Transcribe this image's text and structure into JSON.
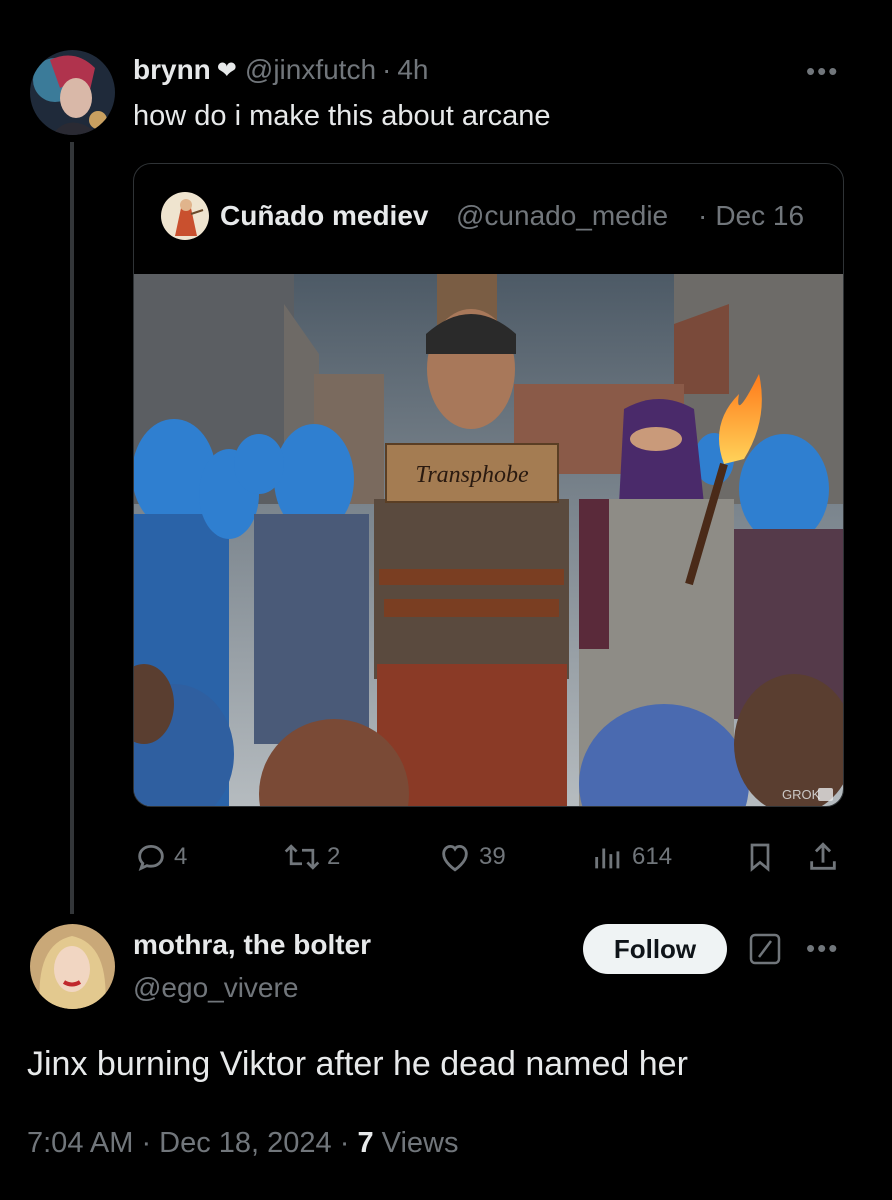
{
  "tweet": {
    "display_name": "brynn",
    "heart_glyph": "❤",
    "handle": "@jinxfutch",
    "separator": "·",
    "time": "4h",
    "text": "how do i make this about arcane",
    "more": "•••"
  },
  "quote": {
    "display_name": "Cuñado mediev",
    "handle": "@cunado_medie",
    "separator": "·",
    "date": "Dec 16",
    "image": {
      "sign_text": "Transphobe",
      "watermark": "GROK"
    }
  },
  "actions": {
    "replies": "4",
    "reposts": "2",
    "likes": "39",
    "views": "614"
  },
  "reply": {
    "display_name": "mothra, the bolter",
    "handle": "@ego_vivere",
    "follow_label": "Follow",
    "more": "•••",
    "text": "Jinx burning Viktor after he dead named her",
    "timestamp": "7:04 AM · Dec 18, 2024 ·",
    "views_count": "7",
    "views_label": "Views"
  },
  "colors": {
    "background": "#000000",
    "text_primary": "#e7e9ea",
    "text_muted": "#71767b",
    "border": "#2f3336",
    "follow_bg": "#eff3f4"
  }
}
